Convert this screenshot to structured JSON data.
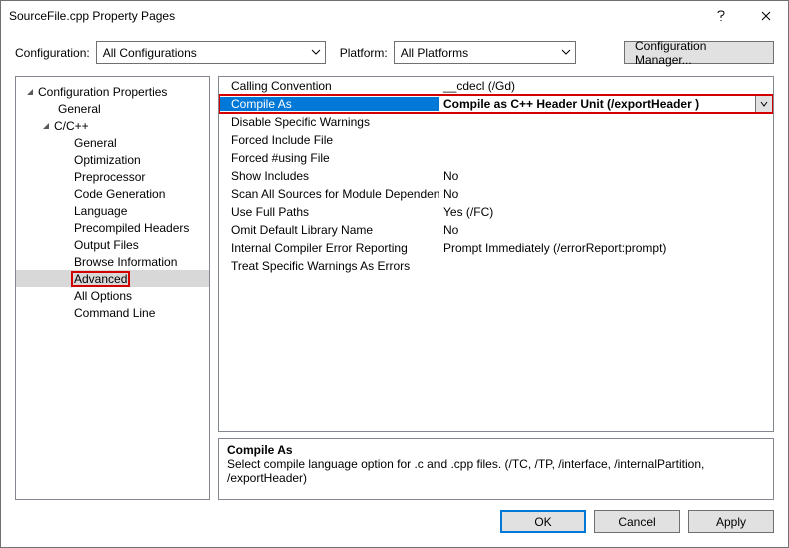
{
  "title": "SourceFile.cpp Property Pages",
  "toprow": {
    "config_label": "Configuration:",
    "config_value": "All Configurations",
    "platform_label": "Platform:",
    "platform_value": "All Platforms",
    "cm_button": "Configuration Manager..."
  },
  "tree": {
    "root": "Configuration Properties",
    "general": "General",
    "cpp": "C/C++",
    "items": [
      "General",
      "Optimization",
      "Preprocessor",
      "Code Generation",
      "Language",
      "Precompiled Headers",
      "Output Files",
      "Browse Information",
      "Advanced",
      "All Options",
      "Command Line"
    ]
  },
  "grid": [
    {
      "name": "Calling Convention",
      "value": "__cdecl (/Gd)"
    },
    {
      "name": "Compile As",
      "value": "Compile as C++ Header Unit (/exportHeader )"
    },
    {
      "name": "Disable Specific Warnings",
      "value": ""
    },
    {
      "name": "Forced Include File",
      "value": ""
    },
    {
      "name": "Forced #using File",
      "value": ""
    },
    {
      "name": "Show Includes",
      "value": "No"
    },
    {
      "name": "Scan All Sources for Module Dependencies",
      "value": "No"
    },
    {
      "name": "Use Full Paths",
      "value": "Yes (/FC)"
    },
    {
      "name": "Omit Default Library Name",
      "value": "No"
    },
    {
      "name": "Internal Compiler Error Reporting",
      "value": "Prompt Immediately (/errorReport:prompt)"
    },
    {
      "name": "Treat Specific Warnings As Errors",
      "value": ""
    }
  ],
  "desc": {
    "title": "Compile As",
    "text": "Select compile language option for .c and .cpp files.     (/TC, /TP, /interface, /internalPartition, /exportHeader)"
  },
  "footer": {
    "ok": "OK",
    "cancel": "Cancel",
    "apply": "Apply"
  }
}
